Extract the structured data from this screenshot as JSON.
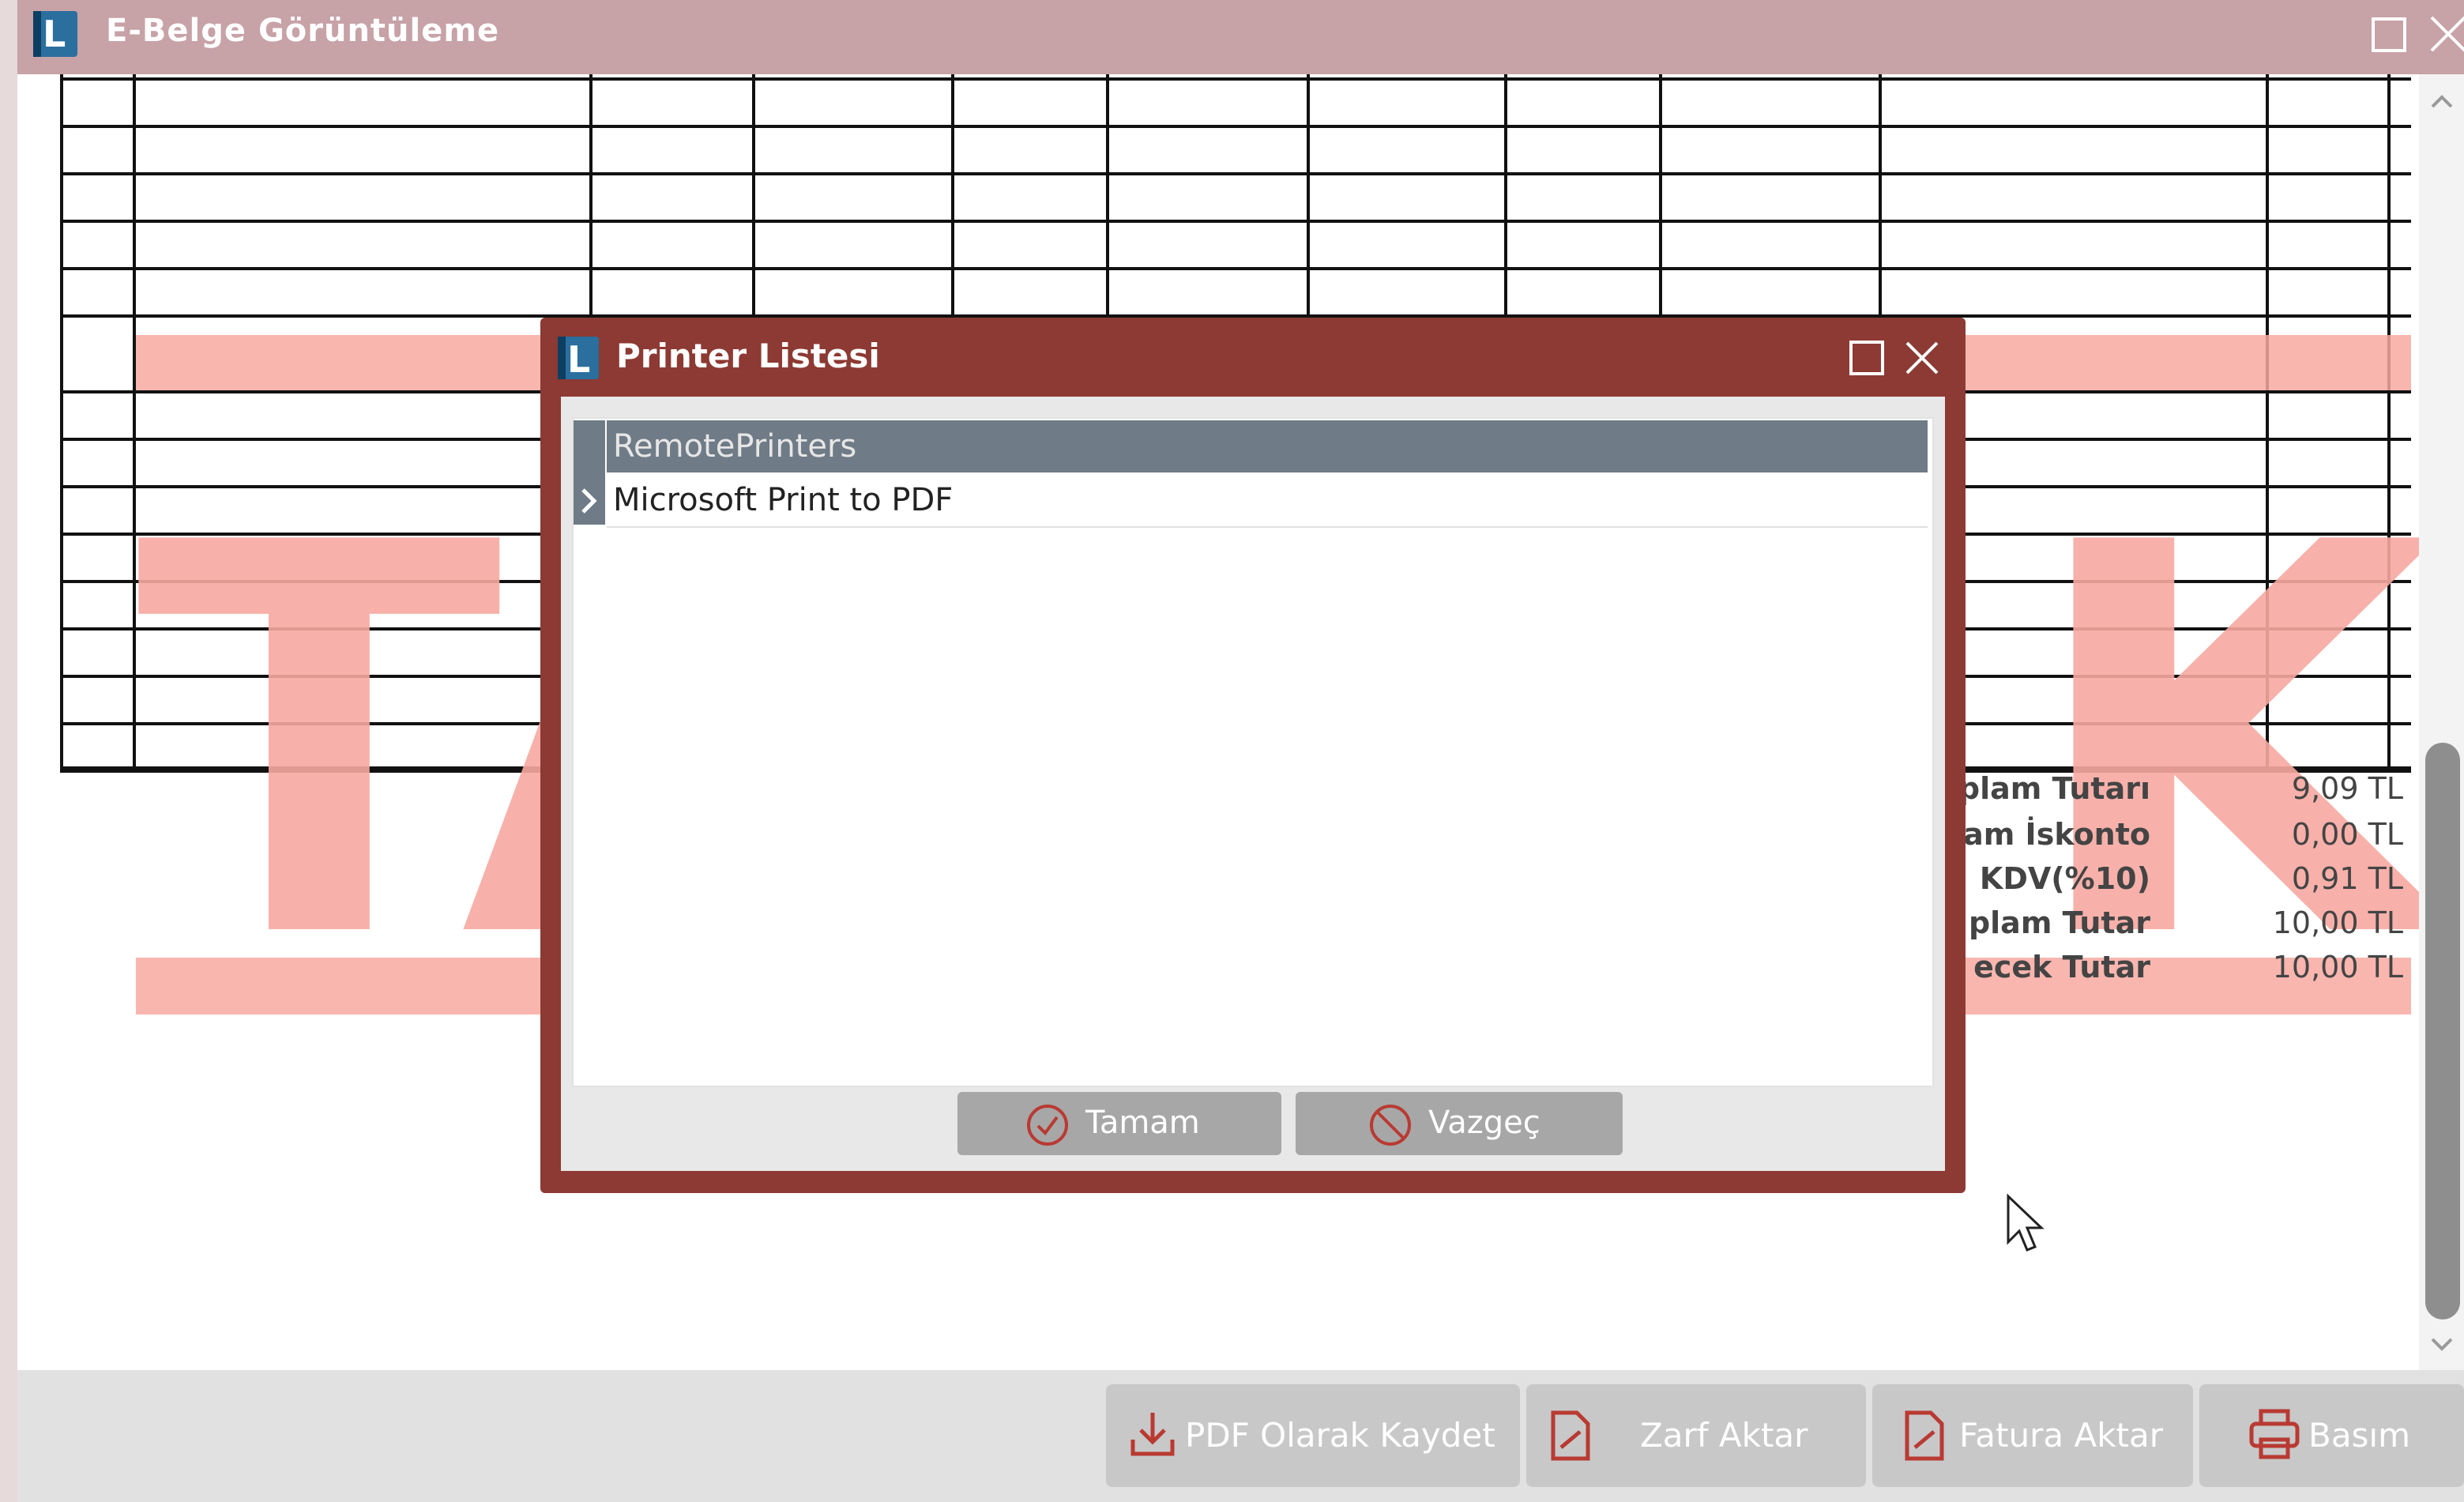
{
  "window": {
    "title": "E-Belge Görüntüleme"
  },
  "document": {
    "watermark_left": "TA",
    "watermark_right": "K",
    "totals": [
      {
        "label": "plam Tutarı",
        "value": "9,09 TL"
      },
      {
        "label": "am İskonto",
        "value": "0,00 TL"
      },
      {
        "label": "KDV(%10)",
        "value": "0,91 TL"
      },
      {
        "label": "plam Tutar",
        "value": "10,00 TL"
      },
      {
        "label": "ecek Tutar",
        "value": "10,00 TL"
      }
    ]
  },
  "toolbar": {
    "pdf_label": "PDF Olarak Kaydet",
    "envelope_label": "Zarf Aktar",
    "invoice_label": "Fatura Aktar",
    "print_label": "Basım"
  },
  "dialog": {
    "title": "Printer Listesi",
    "printers": [
      "RemotePrinters",
      "Microsoft Print to PDF"
    ],
    "selected_index": 0,
    "ok_label": "Tamam",
    "cancel_label": "Vazgeç"
  },
  "colors": {
    "title_bar": "#c7a2a7",
    "dialog_frame": "#8c3a33",
    "watermark": "#f7a9a1",
    "selected_row": "#6f7b86"
  }
}
